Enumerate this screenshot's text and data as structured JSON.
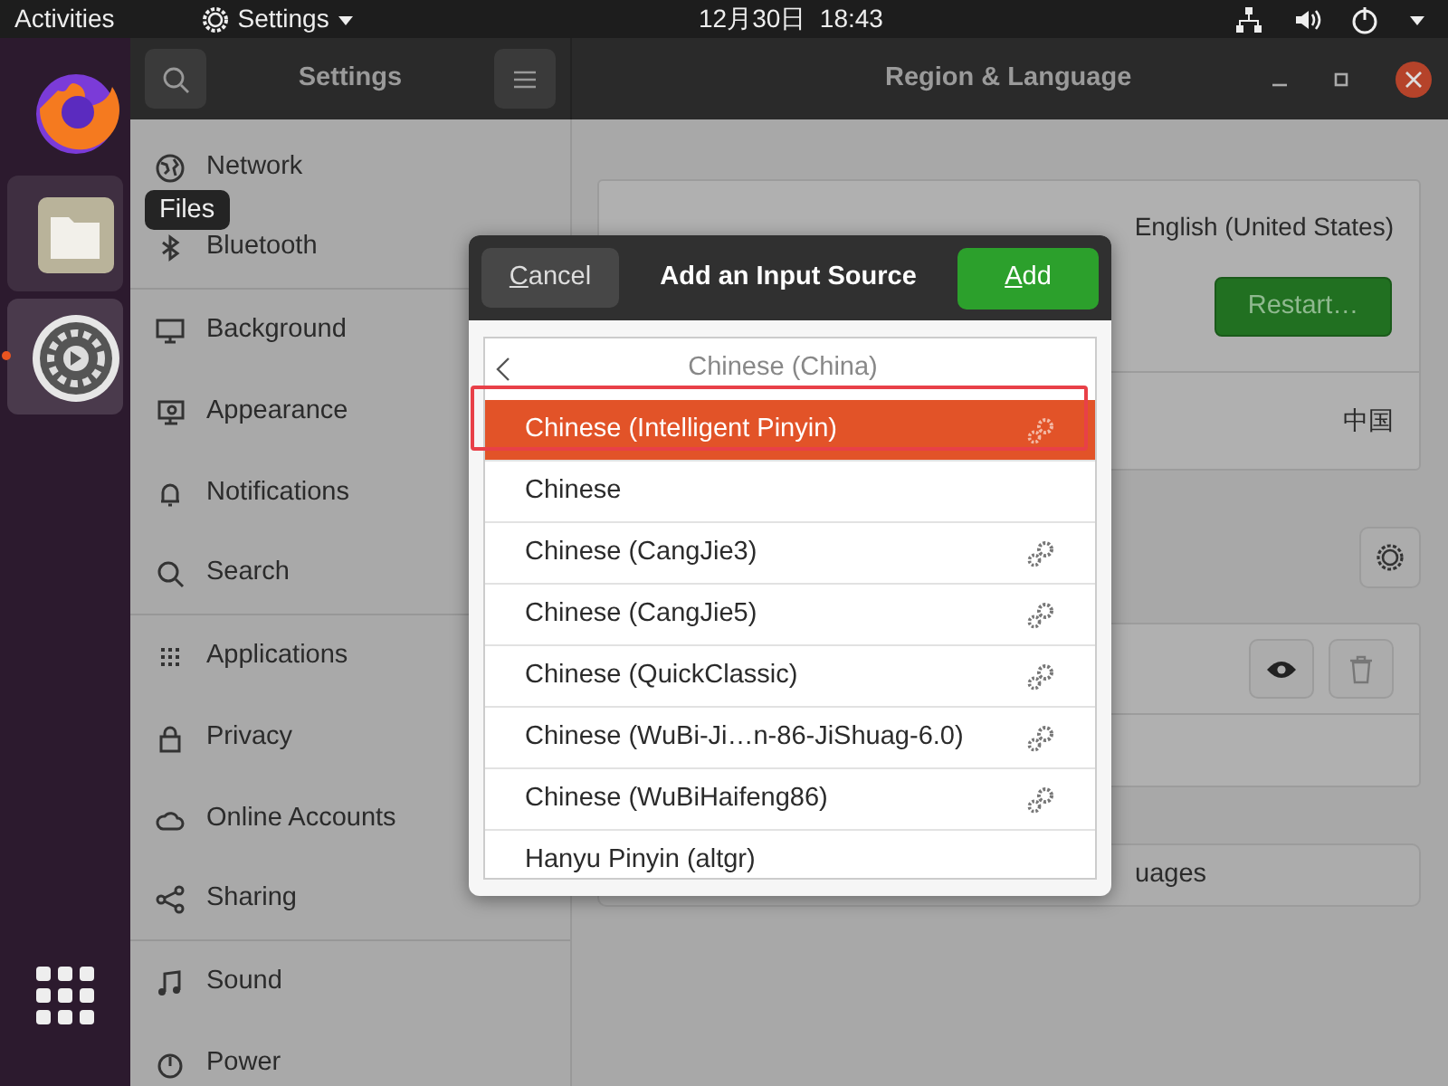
{
  "top_bar": {
    "activities": "Activities",
    "app_menu": "Settings",
    "clock": "12月30日  18:43"
  },
  "dock": {
    "items": [
      {
        "kind": "firefox",
        "active": false
      },
      {
        "kind": "files",
        "active": false
      },
      {
        "kind": "settings",
        "active": true
      }
    ],
    "tooltip": "Files"
  },
  "window": {
    "sidebar_title": "Settings",
    "title": "Region & Language"
  },
  "sidebar": {
    "items": [
      {
        "label": "Network",
        "kind": "globe",
        "group_end": false
      },
      {
        "label": "Bluetooth",
        "kind": "bluetooth",
        "group_end": true
      },
      {
        "label": "Background",
        "kind": "monitor",
        "group_end": false
      },
      {
        "label": "Appearance",
        "kind": "appearance",
        "group_end": false
      },
      {
        "label": "Notifications",
        "kind": "bell",
        "group_end": false
      },
      {
        "label": "Search",
        "kind": "search",
        "group_end": true
      },
      {
        "label": "Applications",
        "kind": "grid",
        "group_end": false
      },
      {
        "label": "Privacy",
        "kind": "lock",
        "group_end": false
      },
      {
        "label": "Online Accounts",
        "kind": "cloud",
        "group_end": false
      },
      {
        "label": "Sharing",
        "kind": "share",
        "group_end": true
      },
      {
        "label": "Sound",
        "kind": "note",
        "group_end": false
      },
      {
        "label": "Power",
        "kind": "power",
        "group_end": false
      }
    ]
  },
  "panel": {
    "language_value": "English (United States)",
    "restart_button": "Restart…",
    "formats_value": "中国",
    "manage_button": "uages"
  },
  "dialog": {
    "cancel": "Cancel",
    "title": "Add an Input Source",
    "add": "Add",
    "header": "Chinese (China)",
    "rows": [
      {
        "label": "Chinese (Intelligent Pinyin)",
        "selected": true,
        "has_settings": true
      },
      {
        "label": "Chinese",
        "selected": false,
        "has_settings": false
      },
      {
        "label": "Chinese (CangJie3)",
        "selected": false,
        "has_settings": true
      },
      {
        "label": "Chinese (CangJie5)",
        "selected": false,
        "has_settings": true
      },
      {
        "label": "Chinese (QuickClassic)",
        "selected": false,
        "has_settings": true
      },
      {
        "label": "Chinese (WuBi-Ji…n-86-JiShuag-6.0)",
        "selected": false,
        "has_settings": true
      },
      {
        "label": "Chinese (WuBiHaifeng86)",
        "selected": false,
        "has_settings": true
      },
      {
        "label": "Hanyu Pinyin (altgr)",
        "selected": false,
        "has_settings": false
      }
    ]
  }
}
